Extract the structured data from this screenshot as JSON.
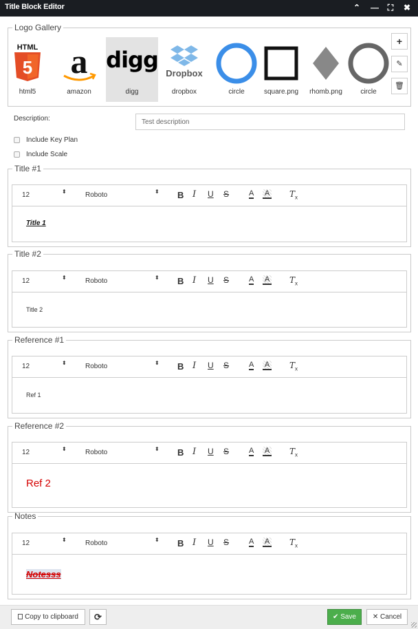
{
  "window": {
    "title": "Title Block Editor",
    "buttons": [
      "⌃",
      "—",
      "⛶",
      "✖"
    ]
  },
  "gallery": {
    "legend": "Logo Gallery",
    "logos": [
      {
        "label": "html5",
        "icon": "html5-logo-icon",
        "selected": false
      },
      {
        "label": "amazon",
        "icon": "amazon-logo-icon",
        "selected": false
      },
      {
        "label": "digg",
        "icon": "digg-logo-icon",
        "selected": true
      },
      {
        "label": "dropbox",
        "icon": "dropbox-logo-icon",
        "selected": false
      },
      {
        "label": "circle",
        "icon": "circle-blue-icon",
        "selected": false
      },
      {
        "label": "square.png",
        "icon": "square-icon",
        "selected": false
      },
      {
        "label": "rhomb.png",
        "icon": "rhomb-icon",
        "selected": false
      },
      {
        "label": "circle",
        "icon": "circle-gray-icon",
        "selected": false
      }
    ],
    "html5_text": "HTML",
    "digg_text": "digg",
    "dropbox_text": "Dropbox",
    "side_buttons": {
      "add": "+",
      "edit": "✎",
      "delete": "🗑"
    }
  },
  "description": {
    "label": "Description:",
    "value": "Test description"
  },
  "checkboxes": [
    {
      "label": "Include Key Plan",
      "checked": false
    },
    {
      "label": "Include Scale",
      "checked": false
    }
  ],
  "toolbar": {
    "size": "12",
    "font": "Roboto",
    "bold": "B",
    "italic": "I",
    "underline": "U",
    "strike": "S",
    "color": "A",
    "bg": "A",
    "clear": "T",
    "clear_sub": "x",
    "arrows": "⬍"
  },
  "sections": [
    {
      "legend": "Title #1",
      "text": "Title 1"
    },
    {
      "legend": "Title #2",
      "text": "Title 2"
    },
    {
      "legend": "Reference #1",
      "text": "Ref 1"
    },
    {
      "legend": "Reference #2",
      "text": "Ref 2",
      "color": "#d40000"
    },
    {
      "legend": "Notes",
      "text": "Notesss",
      "color": "#d40000"
    }
  ],
  "footer": {
    "copy": "Copy to clipboard",
    "refresh": "⟳",
    "save": "Save",
    "cancel": "Cancel"
  },
  "colors": {
    "titlebar": "#1a1d22",
    "save": "#4cae4c",
    "accent_red": "#d40000",
    "circle_blue": "#3b8ee8"
  }
}
